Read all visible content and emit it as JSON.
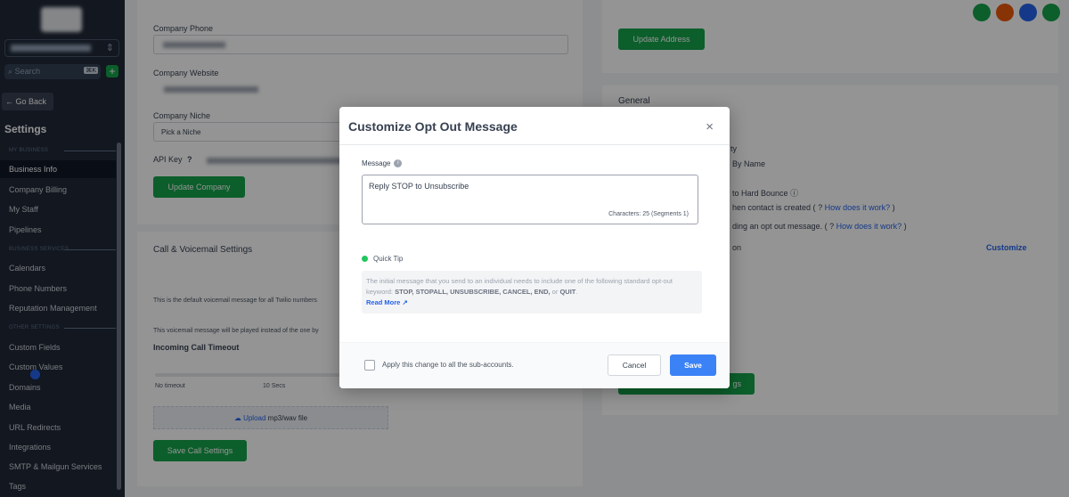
{
  "sidebar": {
    "search_placeholder": "Search",
    "search_shortcut": "⌘K",
    "add_label": "+",
    "go_back": "Go Back",
    "title": "Settings",
    "sections": {
      "my_business": "MY BUSINESS",
      "business_services": "BUSINESS SERVICES",
      "other_settings": "OTHER SETTINGS"
    },
    "items": [
      "Business Info",
      "Company Billing",
      "My Staff",
      "Pipelines",
      "Calendars",
      "Phone Numbers",
      "Reputation Management",
      "Custom Fields",
      "Custom Values",
      "Domains",
      "Media",
      "URL Redirects",
      "Integrations",
      "SMTP & Mailgun Services",
      "Tags"
    ]
  },
  "company_card": {
    "phone_label": "Company Phone",
    "website_label": "Company Website",
    "niche_label": "Company Niche",
    "niche_value": "Pick a Niche",
    "api_key_label": "API Key",
    "update_button": "Update Company"
  },
  "call_card": {
    "title": "Call & Voicemail Settings",
    "default_text": "This is the default voicemail message for all Twilio numbers",
    "played_text": "This voicemail message will be played instead of the one by",
    "timeout_label": "Incoming Call Timeout",
    "tick_no_timeout": "No timeout",
    "tick_10": "10 Secs",
    "upload_link": "Upload",
    "upload_text": "mp3/wav file",
    "save_button": "Save Call Settings"
  },
  "address_card": {
    "update_button": "Update Address"
  },
  "general_card": {
    "title": "General",
    "line_ty": "ty",
    "line_by_name": "By Name",
    "line_hard_bounce": "to Hard Bounce",
    "line_contact_created": "hen contact is created (",
    "line_opt_out": "ding an opt out message. (",
    "how_link": "How does it work?",
    "line_on": "on",
    "customize_link": "Customize",
    "save_button_fragment": "gs"
  },
  "avatars": [
    "#16a34a",
    "#ea580c",
    "#2563eb",
    "#16a34a"
  ],
  "modal": {
    "title": "Customize Opt Out Message",
    "close": "×",
    "message_label": "Message",
    "message_value": "Reply STOP to Unsubscribe",
    "char_count": "Characters: 25 (Segments 1)",
    "tip_title": "Quick Tip",
    "tip_text": "The initial message that you send to an individual needs to include one of the following standard opt-out keyword:",
    "tip_keywords": "STOP, STOPALL, UNSUBSCRIBE, CANCEL, END,",
    "tip_or": "or",
    "tip_last": "QUIT",
    "read_more": "Read More",
    "apply_label": "Apply this change to all the sub-accounts.",
    "cancel": "Cancel",
    "save": "Save"
  }
}
